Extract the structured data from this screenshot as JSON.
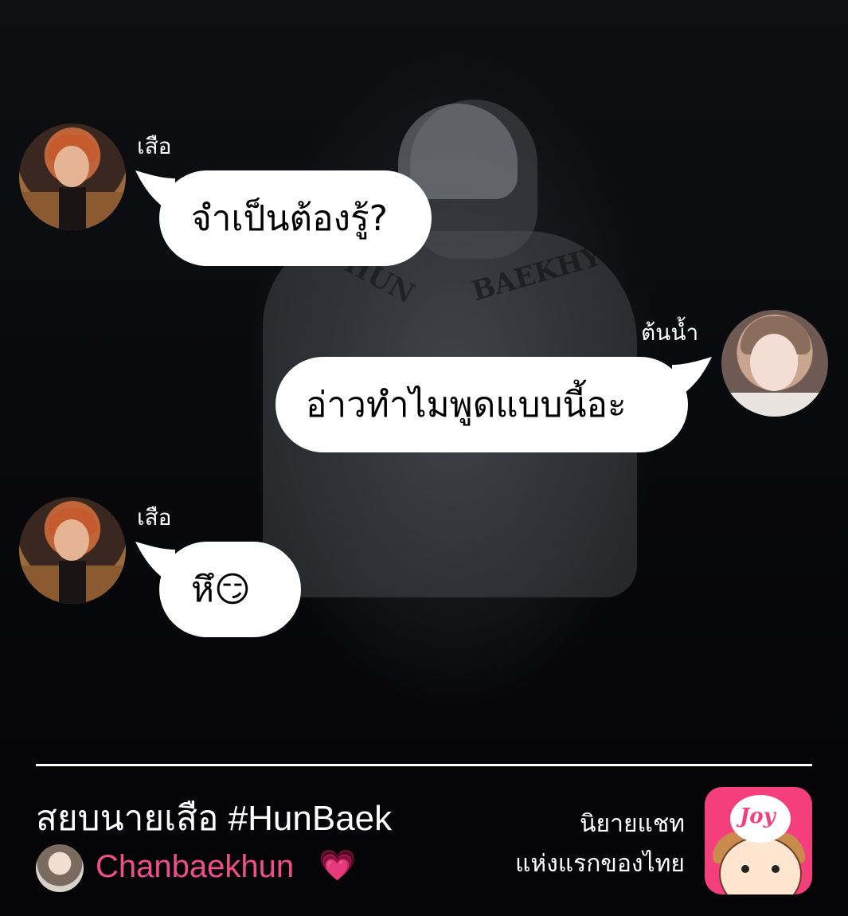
{
  "messages": [
    {
      "sender": "เสือ",
      "text": "จำเป็นต้องรู้?",
      "side": "left",
      "avatar_icon": "tiger-avatar"
    },
    {
      "sender": "ต้นน้ำ",
      "text": "อ่าวทำไมพูดแบบนี้อะ",
      "side": "right",
      "avatar_icon": "water-avatar"
    },
    {
      "sender": "เสือ",
      "text": "หึ😏",
      "side": "left",
      "avatar_icon": "tiger-avatar"
    }
  ],
  "background": {
    "jersey_left": "HUN",
    "jersey_right": "BAEKHYU"
  },
  "footer": {
    "story_title": "สยบนายเสือ #HunBaek",
    "author": "Chanbaekhun",
    "author_badge": "💗",
    "tagline_line1": "นิยายแชท",
    "tagline_line2": "แห่งแรกของไทย",
    "app_logo_text": "Joy"
  },
  "colors": {
    "accent_pink": "#f04e88",
    "bubble": "#ffffff",
    "background": "#050507"
  }
}
